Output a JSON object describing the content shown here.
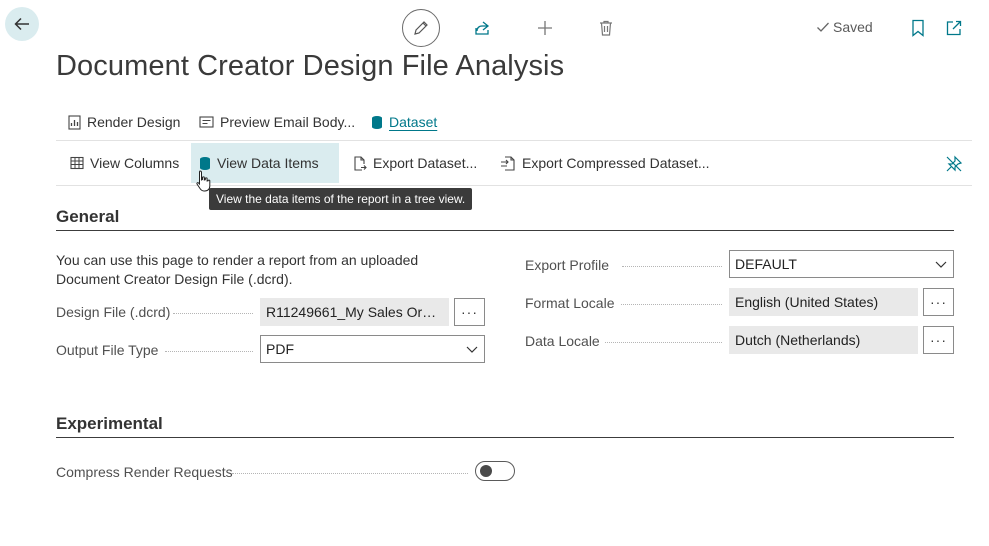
{
  "header": {
    "title": "Document Creator Design File Analysis",
    "saved_label": "Saved"
  },
  "actions_primary": [
    {
      "label": "Render Design",
      "icon": "report-icon"
    },
    {
      "label": "Preview Email Body...",
      "icon": "email-icon"
    },
    {
      "label": "Dataset",
      "icon": "database-icon",
      "active": true
    }
  ],
  "actions_secondary": [
    {
      "label": "View Columns",
      "icon": "columns-icon"
    },
    {
      "label": "View Data Items",
      "icon": "database-icon",
      "highlighted": true
    },
    {
      "label": "Export Dataset...",
      "icon": "export-file-icon"
    },
    {
      "label": "Export Compressed Dataset...",
      "icon": "export-compressed-icon"
    }
  ],
  "tooltip": "View the data items of the report in a tree view.",
  "general": {
    "title": "General",
    "description": "You can use this page to render a report from an uploaded Document Creator Design File (.dcrd).",
    "design_file_label": "Design File (.dcrd)",
    "design_file_value": "R11249661_My Sales Order...",
    "output_type_label": "Output File Type",
    "output_type_value": "PDF",
    "export_profile_label": "Export Profile",
    "export_profile_value": "DEFAULT",
    "format_locale_label": "Format Locale",
    "format_locale_value": "English (United States)",
    "data_locale_label": "Data Locale",
    "data_locale_value": "Dutch (Netherlands)",
    "ellipsis": "···"
  },
  "experimental": {
    "title": "Experimental",
    "compress_label": "Compress Render Requests",
    "compress_enabled": false
  },
  "colors": {
    "accent": "#00788a",
    "highlight": "#daecef"
  }
}
